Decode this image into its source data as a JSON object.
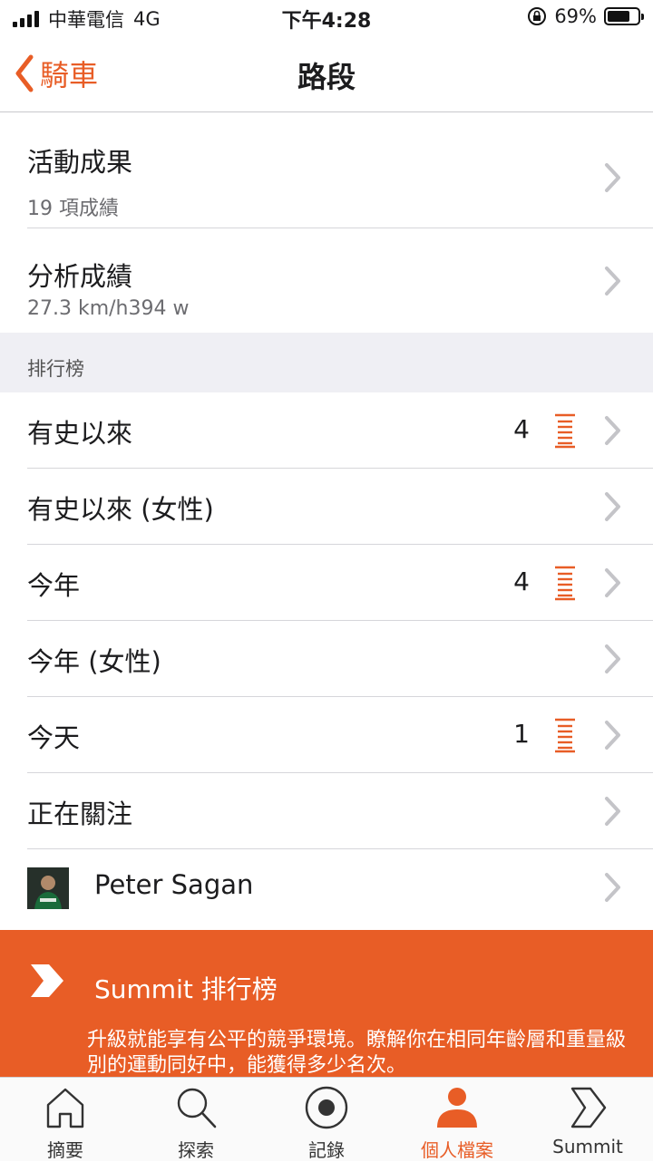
{
  "status_bar": {
    "carrier": "中華電信",
    "network": "4G",
    "time": "下午4:28",
    "battery": "69%"
  },
  "nav": {
    "back_label": "騎車",
    "title": "路段"
  },
  "results": [
    {
      "label": "活動成果",
      "sub": "19 項成績"
    },
    {
      "label": "分析成績",
      "sub": "27.3 km/h394 w"
    }
  ],
  "leaderboard": {
    "section_title": "排行榜",
    "rows": [
      {
        "label": "有史以來",
        "rank": "4"
      },
      {
        "label": "有史以來 (女性)",
        "rank": ""
      },
      {
        "label": "今年",
        "rank": "4"
      },
      {
        "label": "今年 (女性)",
        "rank": ""
      },
      {
        "label": "今天",
        "rank": "1"
      },
      {
        "label": "正在關注",
        "rank": ""
      }
    ],
    "followed_athlete": "Peter Sagan"
  },
  "summit_banner": {
    "title": "Summit 排行榜",
    "description": "升級就能享有公平的競爭環境。瞭解你在相同年齡層和重量級別的運動同好中，能獲得多少名次。"
  },
  "tabs": [
    {
      "label": "摘要",
      "icon": "home-icon",
      "active": false
    },
    {
      "label": "探索",
      "icon": "search-icon",
      "active": false
    },
    {
      "label": "記錄",
      "icon": "record-icon",
      "active": false
    },
    {
      "label": "個人檔案",
      "icon": "profile-icon",
      "active": true
    },
    {
      "label": "Summit",
      "icon": "summit-icon",
      "active": false
    }
  ],
  "colors": {
    "accent": "#e85d26",
    "section_bg": "#efeff4"
  }
}
